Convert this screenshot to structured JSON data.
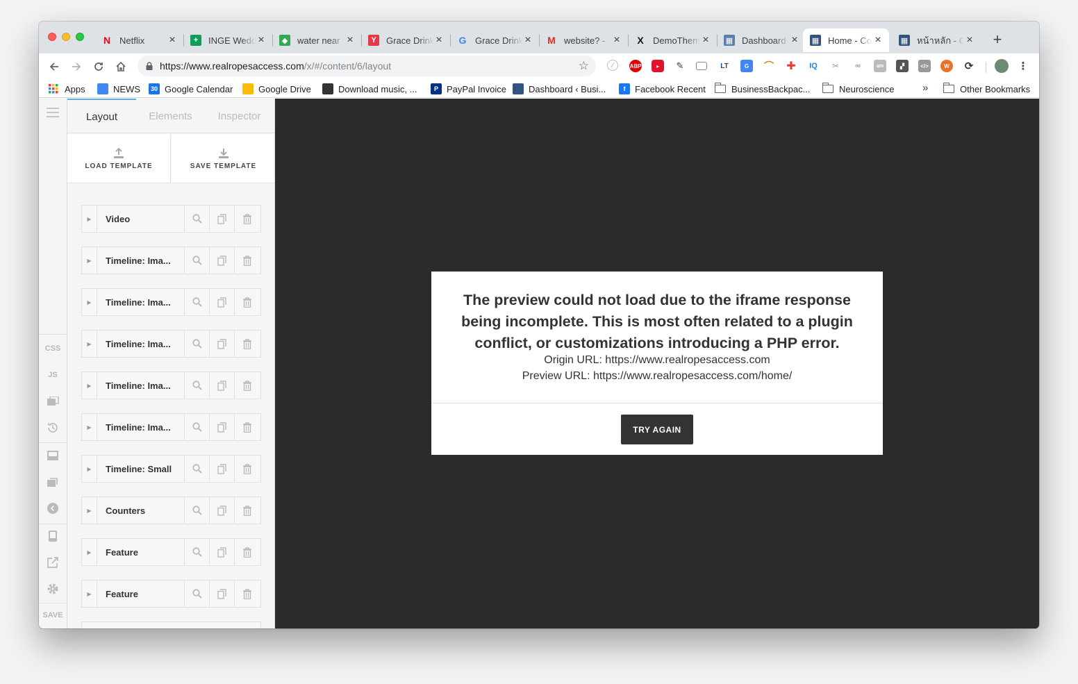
{
  "browser": {
    "tabs": [
      {
        "title": "Netflix",
        "icon": "netflix-icon",
        "icon_glyph": "N",
        "color": "#e50914"
      },
      {
        "title": "INGE Wedd",
        "icon": "sheets-icon",
        "icon_glyph": "+",
        "color": "#0f9d58"
      },
      {
        "title": "water near",
        "icon": "maps-icon",
        "icon_glyph": "◆",
        "color": "#34a853"
      },
      {
        "title": "Grace Drink",
        "icon": "yelp-icon",
        "icon_glyph": "Y",
        "color": "#e63946"
      },
      {
        "title": "Grace Drink",
        "icon": "google-icon",
        "icon_glyph": "G",
        "color": "#4285f4"
      },
      {
        "title": "website? -",
        "icon": "gmail-icon",
        "icon_glyph": "M",
        "color": "#d93025"
      },
      {
        "title": "DemoThem",
        "icon": "x-icon",
        "icon_glyph": "X",
        "color": "#111111"
      },
      {
        "title": "Dashboard",
        "icon": "dashboard-icon",
        "icon_glyph": "▦",
        "color": "#5b7fa8"
      },
      {
        "title": "Home - Co",
        "icon": "grid-icon",
        "icon_glyph": "▦",
        "color": "#33547a"
      },
      {
        "title": "หน้าหลัก - C",
        "icon": "grid-icon",
        "icon_glyph": "▦",
        "color": "#33547a"
      }
    ],
    "url_host": "https://www.realropesaccess.com",
    "url_path": "/x/#/content/6/layout",
    "bookmarks": [
      {
        "label": "Apps",
        "icon": "apps-grid-icon",
        "color": "#ea4335"
      },
      {
        "label": "NEWS",
        "icon": "news-icon",
        "color": "#4285f4"
      },
      {
        "label": "Google Calendar",
        "icon": "calendar-icon",
        "color": "#1a73e8",
        "glyph": "30"
      },
      {
        "label": "Google Drive",
        "icon": "drive-icon",
        "color": "#fbbc04"
      },
      {
        "label": "Download music, ...",
        "icon": "download-icon",
        "color": "#333333"
      },
      {
        "label": "PayPal Invoice",
        "icon": "paypal-icon",
        "color": "#003087",
        "glyph": "P"
      },
      {
        "label": "Dashboard ‹ Busi...",
        "icon": "grid-icon",
        "color": "#33547a"
      },
      {
        "label": "Facebook Recent",
        "icon": "facebook-icon",
        "color": "#1877f2",
        "glyph": "f"
      },
      {
        "label": "BusinessBackpac...",
        "icon": "folder-icon"
      },
      {
        "label": "Neuroscience",
        "icon": "folder-icon"
      }
    ],
    "overflow": "»",
    "other_bookmarks": "Other Bookmarks"
  },
  "rail": {
    "css": "CSS",
    "js": "JS",
    "save": "SAVE"
  },
  "panel": {
    "tabs": [
      "Layout",
      "Elements",
      "Inspector"
    ],
    "load_template": "LOAD TEMPLATE",
    "save_template": "SAVE TEMPLATE",
    "elements": [
      "Video",
      "Timeline: Ima...",
      "Timeline: Ima...",
      "Timeline: Ima...",
      "Timeline: Ima...",
      "Timeline: Ima...",
      "Timeline: Small",
      "Counters",
      "Feature",
      "Feature"
    ]
  },
  "modal": {
    "message": "The preview could not load due to the iframe response being incomplete. This is most often related to a plugin conflict, or customizations introducing a PHP error.",
    "origin": "Origin URL: https://www.realropesaccess.com",
    "preview": "Preview URL: https://www.realropesaccess.com/home/",
    "button": "TRY AGAIN"
  }
}
